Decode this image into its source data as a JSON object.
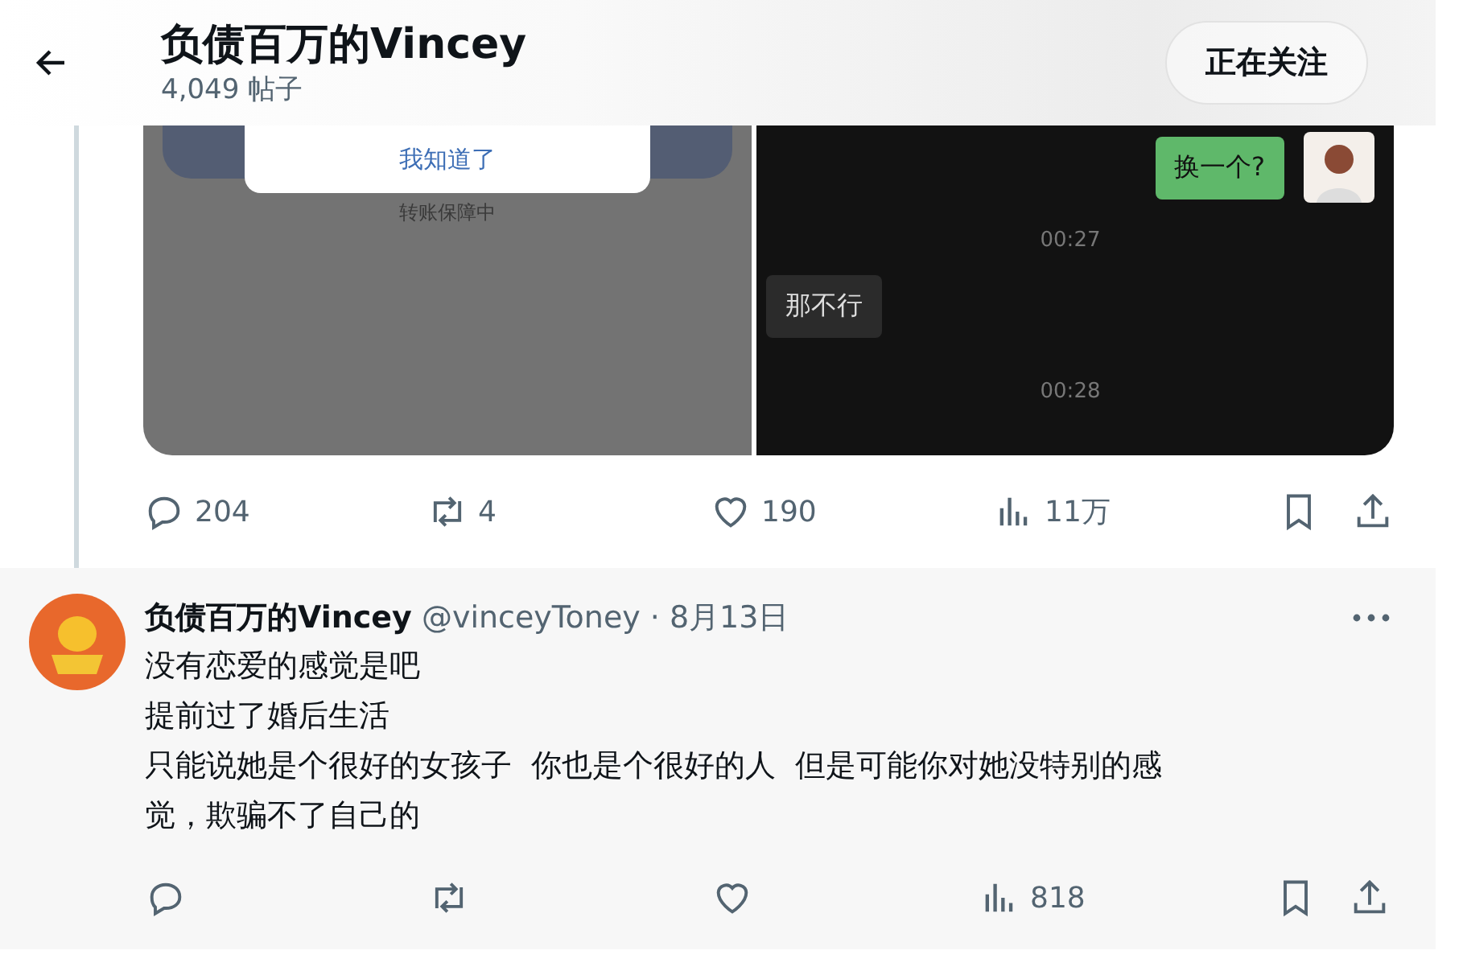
{
  "header": {
    "title": "负债百万的Vincey",
    "post_count": "4,049 帖子",
    "follow_button": "正在关注"
  },
  "media": {
    "left": {
      "dialog_button": "我知道了",
      "caption": "转账保障中"
    },
    "right": {
      "messages": [
        {
          "kind": "sent",
          "text": "换一个?"
        },
        {
          "kind": "time",
          "text": "00:27"
        },
        {
          "kind": "received",
          "text": "那不行"
        },
        {
          "kind": "time",
          "text": "00:28"
        }
      ]
    }
  },
  "post_actions": {
    "replies": "204",
    "reposts": "4",
    "likes": "190",
    "views": "11万"
  },
  "reply": {
    "author": "负债百万的Vincey",
    "handle": "@vinceyToney",
    "date": "· 8月13日",
    "lines": [
      "没有恋爱的感觉是吧",
      "提前过了婚后生活",
      "只能说她是个很好的女孩子  你也是个很好的人  但是可能你对她没特别的感觉，欺骗不了自己的"
    ],
    "actions": {
      "views": "818"
    }
  }
}
